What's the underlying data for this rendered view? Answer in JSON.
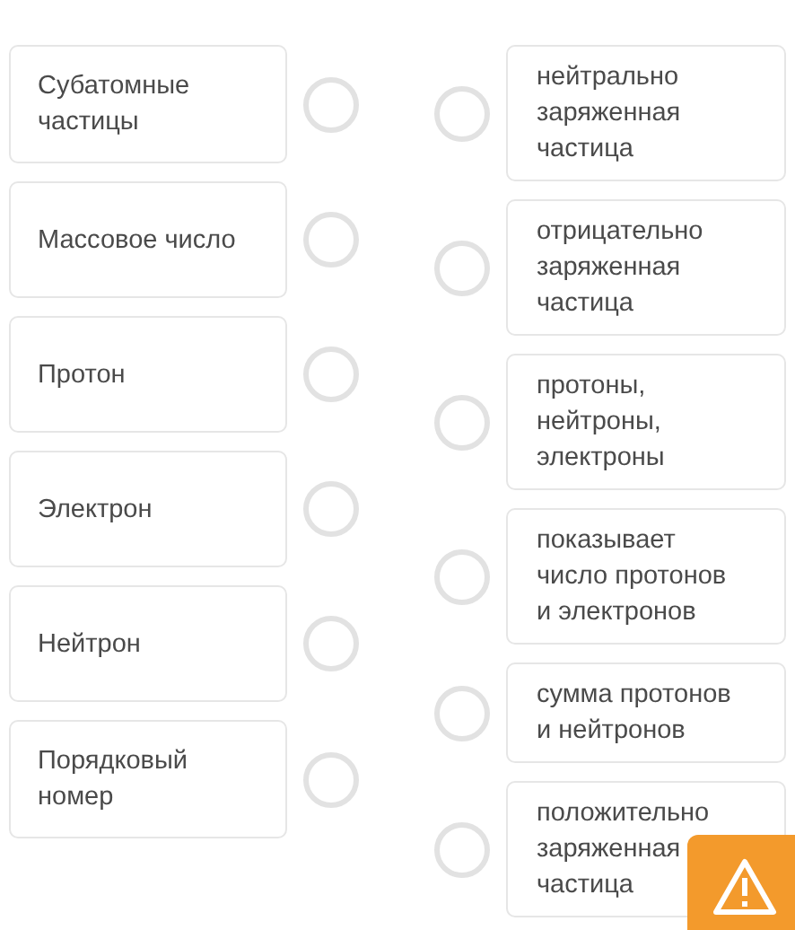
{
  "left_items": [
    {
      "text": "Субатомные частицы"
    },
    {
      "text": "Массовое число"
    },
    {
      "text": "Протон"
    },
    {
      "text": "Электрон"
    },
    {
      "text": "Нейтрон"
    },
    {
      "text": "Порядковый номер"
    }
  ],
  "right_items": [
    {
      "text": "нейтрально заряженная частица"
    },
    {
      "text": "отрицательно заряженная частица"
    },
    {
      "text": "протоны, нейтроны, электроны"
    },
    {
      "text": "показывает число протонов и электронов"
    },
    {
      "text": "сумма протонов и нейтронов"
    },
    {
      "text": "положительно заряженная частица"
    }
  ],
  "alert": {
    "kind": "warning"
  }
}
